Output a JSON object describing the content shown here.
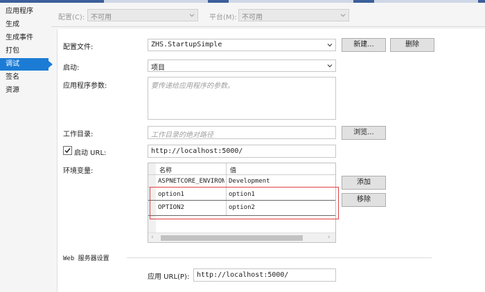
{
  "sidebar": {
    "items": [
      {
        "label": "应用程序"
      },
      {
        "label": "生成"
      },
      {
        "label": "生成事件"
      },
      {
        "label": "打包"
      },
      {
        "label": "调试"
      },
      {
        "label": "签名"
      },
      {
        "label": "资源"
      }
    ],
    "active_index": 4
  },
  "topbar": {
    "config_label": "配置(C):",
    "config_value": "不可用",
    "platform_label": "平台(M):",
    "platform_value": "不可用"
  },
  "profile": {
    "label": "配置文件:",
    "value": "ZHS.StartupSimple",
    "new_button": "新建...",
    "delete_button": "删除"
  },
  "launch": {
    "label": "启动:",
    "value": "项目"
  },
  "args": {
    "label": "应用程序参数:",
    "placeholder": "要传递给应用程序的参数。"
  },
  "workdir": {
    "label": "工作目录:",
    "placeholder": "工作目录的绝对路径",
    "browse_button": "浏览..."
  },
  "launch_url": {
    "checked": true,
    "label": "启动 URL:",
    "value": "http://localhost:5000/"
  },
  "env": {
    "label": "环境变量:",
    "columns": [
      "名称",
      "值"
    ],
    "rows": [
      {
        "name": "ASPNETCORE_ENVIRONMENT",
        "value": "Development"
      },
      {
        "name": "option1",
        "value": "option1"
      },
      {
        "name": "OPTION2",
        "value": "option2"
      }
    ],
    "add_button": "添加",
    "remove_button": "移除"
  },
  "web_server": {
    "section_title": "Web 服务器设置",
    "app_url_label": "应用 URL(P):",
    "app_url_value": "http://localhost:5000/"
  },
  "colors": {
    "accent": "#1c7cd5",
    "highlight": "#e04040"
  }
}
